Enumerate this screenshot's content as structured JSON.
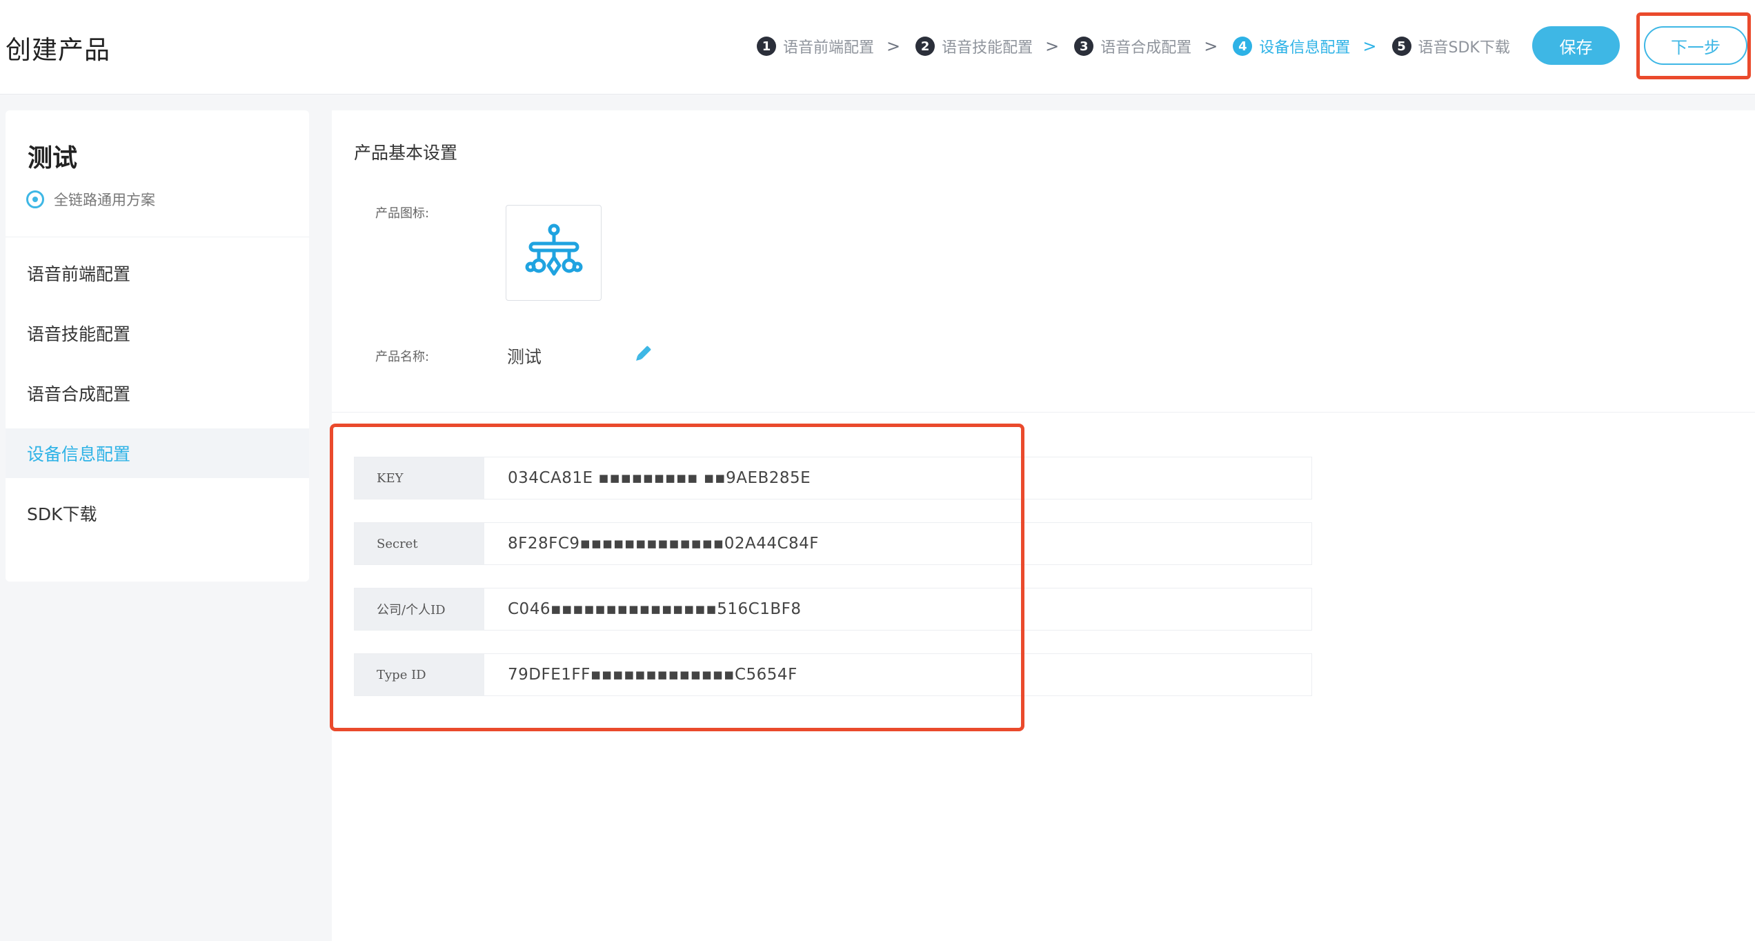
{
  "header": {
    "title": "创建产品",
    "steps": [
      {
        "num": "1",
        "label": "语音前端配置"
      },
      {
        "num": "2",
        "label": "语音技能配置"
      },
      {
        "num": "3",
        "label": "语音合成配置"
      },
      {
        "num": "4",
        "label": "设备信息配置",
        "active": true
      },
      {
        "num": "5",
        "label": "语音SDK下载"
      }
    ],
    "separator": ">",
    "save_label": "保存",
    "next_label": "下一步"
  },
  "sidebar": {
    "product_name": "测试",
    "solution_label": "全链路通用方案",
    "items": [
      {
        "label": "语音前端配置"
      },
      {
        "label": "语音技能配置"
      },
      {
        "label": "语音合成配置"
      },
      {
        "label": "设备信息配置",
        "active": true
      },
      {
        "label": "SDK下载"
      }
    ]
  },
  "main": {
    "section_title": "产品基本设置",
    "icon_label": "产品图标:",
    "name_label": "产品名称:",
    "product_name": "测试",
    "info": [
      {
        "key": "KEY",
        "value": "034CA81E ▪▪▪▪▪▪▪▪▪ ▪▪9AEB285E"
      },
      {
        "key": "Secret",
        "value": "8F28FC9▪▪▪▪▪▪▪▪▪▪▪▪▪02A44C84F"
      },
      {
        "key": "公司/个人ID",
        "value": "C046▪▪▪▪▪▪▪▪▪▪▪▪▪▪▪516C1BF8"
      },
      {
        "key": "Type ID",
        "value": "79DFE1FF▪▪▪▪▪▪▪▪▪▪▪▪▪C5654F"
      }
    ]
  },
  "colors": {
    "accent": "#3eb7e5",
    "active_text": "#2db2e6",
    "highlight": "#ea4a2c"
  },
  "icons": {
    "product": "mobile-hanging-ornament-icon",
    "solution": "circle-dot-icon",
    "edit": "pencil-icon"
  }
}
